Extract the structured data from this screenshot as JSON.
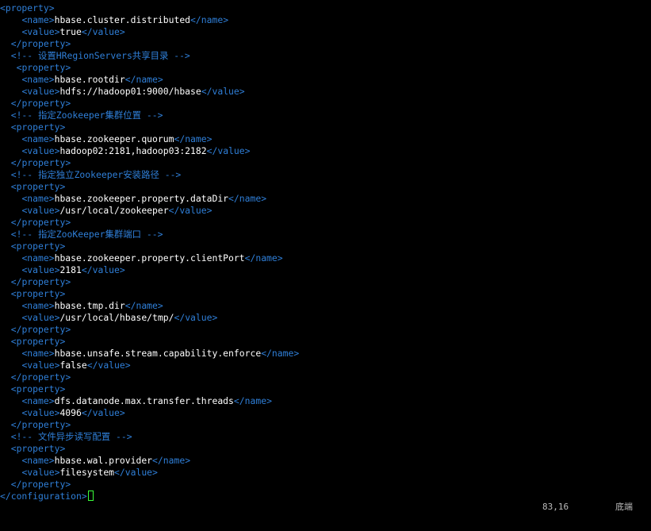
{
  "colors": {
    "background": "#000000",
    "tag": "#2f7fd8",
    "text": "#ffffff",
    "cursor": "#3aff3a"
  },
  "lines": [
    {
      "type": "open",
      "indent": "",
      "tag": "property"
    },
    {
      "type": "elem",
      "indent": "    ",
      "tag": "name",
      "text": "hbase.cluster.distributed"
    },
    {
      "type": "elem",
      "indent": "    ",
      "tag": "value",
      "text": "true"
    },
    {
      "type": "close",
      "indent": "  ",
      "tag": "property"
    },
    {
      "type": "comment",
      "indent": "  ",
      "text": "<!-- 设置HRegionServers共享目录 -->"
    },
    {
      "type": "open",
      "indent": "   ",
      "tag": "property"
    },
    {
      "type": "elem",
      "indent": "    ",
      "tag": "name",
      "text": "hbase.rootdir"
    },
    {
      "type": "elem",
      "indent": "    ",
      "tag": "value",
      "text": "hdfs://hadoop01:9000/hbase"
    },
    {
      "type": "close",
      "indent": "  ",
      "tag": "property"
    },
    {
      "type": "comment",
      "indent": "  ",
      "text": "<!-- 指定Zookeeper集群位置 -->"
    },
    {
      "type": "open",
      "indent": "  ",
      "tag": "property"
    },
    {
      "type": "elem",
      "indent": "    ",
      "tag": "name",
      "text": "hbase.zookeeper.quorum"
    },
    {
      "type": "elem",
      "indent": "    ",
      "tag": "value",
      "text": "hadoop02:2181,hadoop03:2182"
    },
    {
      "type": "close",
      "indent": "  ",
      "tag": "property"
    },
    {
      "type": "comment",
      "indent": "  ",
      "text": "<!-- 指定独立Zookeeper安装路径 -->"
    },
    {
      "type": "open",
      "indent": "  ",
      "tag": "property"
    },
    {
      "type": "elem",
      "indent": "    ",
      "tag": "name",
      "text": "hbase.zookeeper.property.dataDir"
    },
    {
      "type": "elem",
      "indent": "    ",
      "tag": "value",
      "text": "/usr/local/zookeeper"
    },
    {
      "type": "close",
      "indent": "  ",
      "tag": "property"
    },
    {
      "type": "comment",
      "indent": "  ",
      "text": "<!-- 指定ZooKeeper集群端口 -->"
    },
    {
      "type": "open",
      "indent": "  ",
      "tag": "property"
    },
    {
      "type": "elem",
      "indent": "    ",
      "tag": "name",
      "text": "hbase.zookeeper.property.clientPort"
    },
    {
      "type": "elem",
      "indent": "    ",
      "tag": "value",
      "text": "2181"
    },
    {
      "type": "close",
      "indent": "  ",
      "tag": "property"
    },
    {
      "type": "open",
      "indent": "  ",
      "tag": "property"
    },
    {
      "type": "elem",
      "indent": "    ",
      "tag": "name",
      "text": "hbase.tmp.dir"
    },
    {
      "type": "elem",
      "indent": "    ",
      "tag": "value",
      "text": "/usr/local/hbase/tmp/"
    },
    {
      "type": "close",
      "indent": "  ",
      "tag": "property"
    },
    {
      "type": "open",
      "indent": "  ",
      "tag": "property"
    },
    {
      "type": "elem",
      "indent": "    ",
      "tag": "name",
      "text": "hbase.unsafe.stream.capability.enforce"
    },
    {
      "type": "elem",
      "indent": "    ",
      "tag": "value",
      "text": "false"
    },
    {
      "type": "close",
      "indent": "  ",
      "tag": "property"
    },
    {
      "type": "open",
      "indent": "  ",
      "tag": "property"
    },
    {
      "type": "elem",
      "indent": "    ",
      "tag": "name",
      "text": "dfs.datanode.max.transfer.threads"
    },
    {
      "type": "elem",
      "indent": "    ",
      "tag": "value",
      "text": "4096"
    },
    {
      "type": "close",
      "indent": "  ",
      "tag": "property"
    },
    {
      "type": "comment",
      "indent": "  ",
      "text": "<!-- 文件异步读写配置 -->"
    },
    {
      "type": "open",
      "indent": "  ",
      "tag": "property"
    },
    {
      "type": "elem",
      "indent": "    ",
      "tag": "name",
      "text": "hbase.wal.provider"
    },
    {
      "type": "elem",
      "indent": "    ",
      "tag": "value",
      "text": "filesystem"
    },
    {
      "type": "close",
      "indent": "  ",
      "tag": "property"
    },
    {
      "type": "close",
      "indent": "",
      "tag": "configuration",
      "cursor": true
    }
  ],
  "status": {
    "position": "83,16",
    "mode": "底端"
  }
}
